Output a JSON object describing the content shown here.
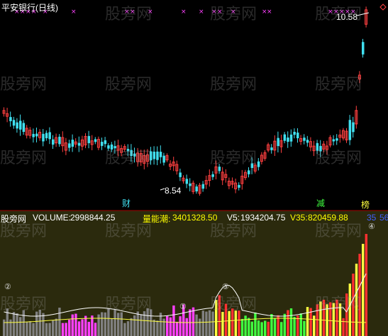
{
  "chart_title": "平安银行(日线)",
  "price_labels": {
    "high": "10.58",
    "low": "8.54"
  },
  "signal_tags": {
    "cai": "财",
    "jian": "减",
    "bang": "榜"
  },
  "volume_header": {
    "source": "股旁网",
    "volume_label": "VOLUME:",
    "volume_value": "2998844.25",
    "energy_label": "量能潮:",
    "energy_value": "3401328.50",
    "v5_label": "V5:",
    "v5_value": "1934204.75",
    "v35_label": "V35:",
    "v35_value": "820459.88",
    "extra_a": "35",
    "extra_b": "56"
  },
  "circle_markers": [
    "②",
    "①",
    "③",
    "④"
  ],
  "watermark_text": "股旁网",
  "colors": {
    "up": "#ff4040",
    "down": "#40e0f0",
    "cross": "#ff40ff",
    "volume_bg": "#2b2a0d",
    "vol_gray": "#808080",
    "vol_magenta": "#ff40ff",
    "vol_green": "#40ff40",
    "vol_yellow": "#ffff40",
    "vol_red": "#ff3030",
    "text_white": "#ffffff",
    "text_cyan": "#40e0f0",
    "text_yellow": "#ffff00"
  }
}
